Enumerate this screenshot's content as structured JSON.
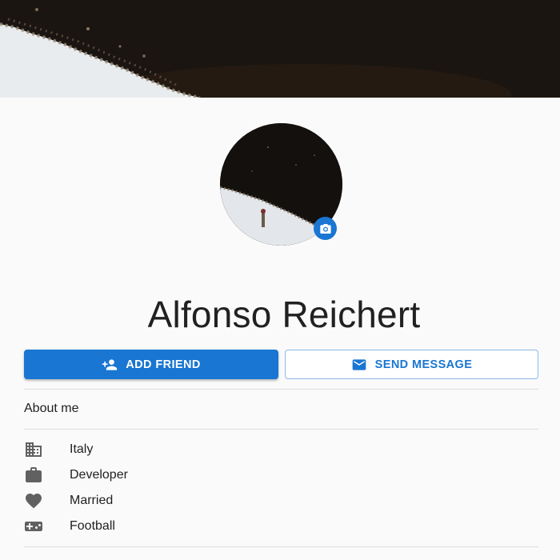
{
  "profile": {
    "name": "Alfonso Reichert"
  },
  "actions": {
    "add_friend_label": "ADD FRIEND",
    "send_message_label": "SEND MESSAGE"
  },
  "about": {
    "title": "About me",
    "items": [
      {
        "icon": "building-icon",
        "label": "Italy"
      },
      {
        "icon": "briefcase-icon",
        "label": "Developer"
      },
      {
        "icon": "heart-icon",
        "label": "Married"
      },
      {
        "icon": "gamepad-icon",
        "label": "Football"
      }
    ]
  },
  "colors": {
    "primary": "#1976d2",
    "icon_gray": "#616161",
    "background": "#fafafa"
  }
}
